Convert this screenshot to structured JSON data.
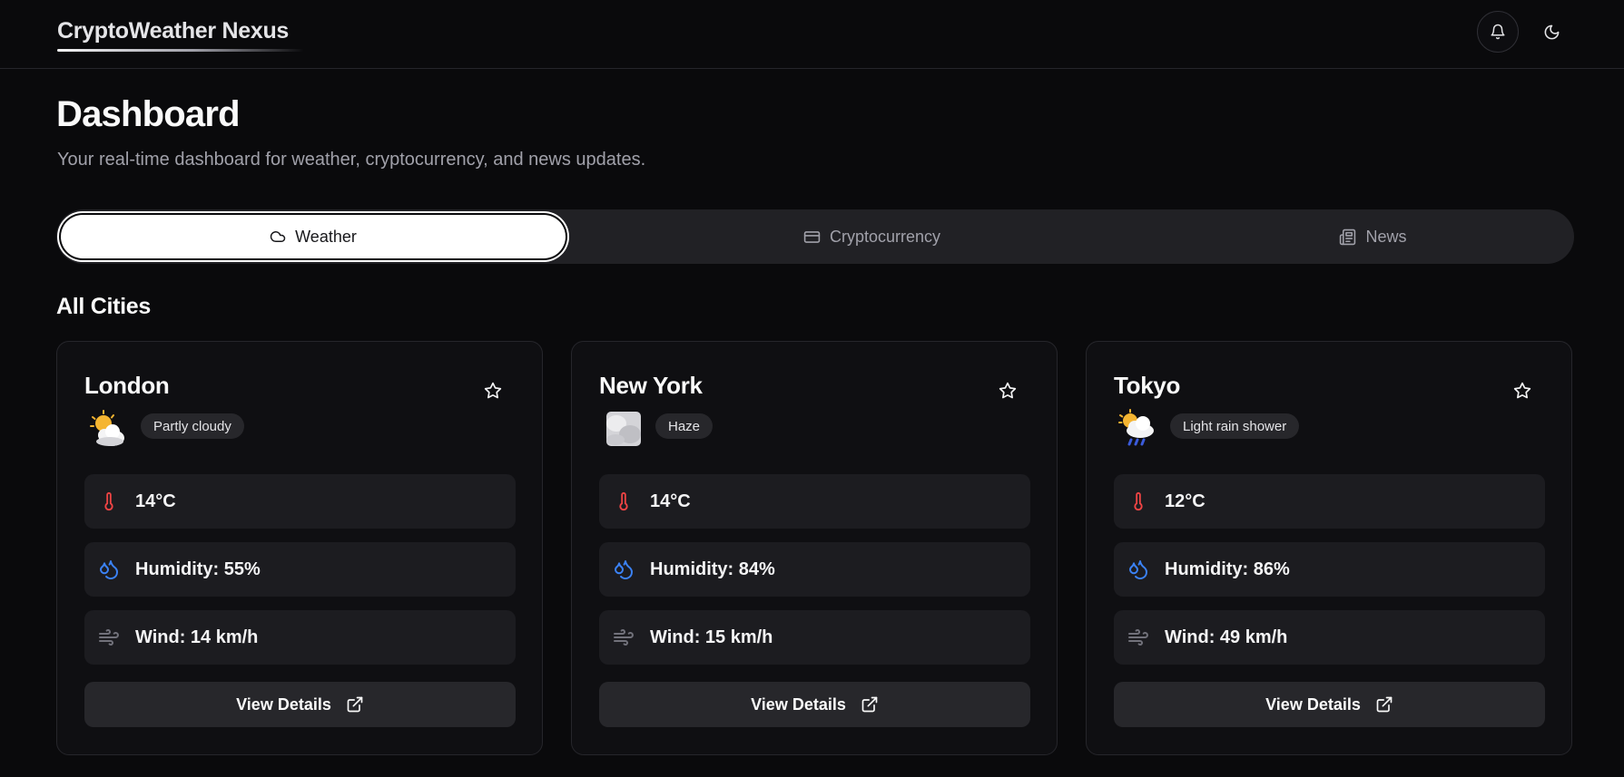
{
  "app": {
    "brand": "CryptoWeather Nexus"
  },
  "header": {
    "notifications_icon": "bell-icon",
    "theme_icon": "moon-icon"
  },
  "page": {
    "title": "Dashboard",
    "subtitle": "Your real-time dashboard for weather, cryptocurrency, and news updates."
  },
  "tabs": [
    {
      "label": "Weather",
      "icon": "cloud-icon",
      "active": true
    },
    {
      "label": "Cryptocurrency",
      "icon": "credit-card-icon",
      "active": false
    },
    {
      "label": "News",
      "icon": "newspaper-icon",
      "active": false
    }
  ],
  "section": {
    "title": "All Cities"
  },
  "cities": [
    {
      "name": "London",
      "condition": "Partly cloudy",
      "condition_icon": "partly-cloudy-icon",
      "temperature": "14°C",
      "humidity": "Humidity: 55%",
      "wind": "Wind: 14 km/h",
      "button_label": "View Details"
    },
    {
      "name": "New York",
      "condition": "Haze",
      "condition_icon": "haze-icon",
      "temperature": "14°C",
      "humidity": "Humidity: 84%",
      "wind": "Wind: 15 km/h",
      "button_label": "View Details"
    },
    {
      "name": "Tokyo",
      "condition": "Light rain shower",
      "condition_icon": "light-rain-shower-icon",
      "temperature": "12°C",
      "humidity": "Humidity: 86%",
      "wind": "Wind: 49 km/h",
      "button_label": "View Details"
    }
  ],
  "colors": {
    "background": "#0a0a0c",
    "temperature_icon": "#ef4444",
    "humidity_icon": "#3b82f6",
    "wind_icon": "#71717a"
  }
}
